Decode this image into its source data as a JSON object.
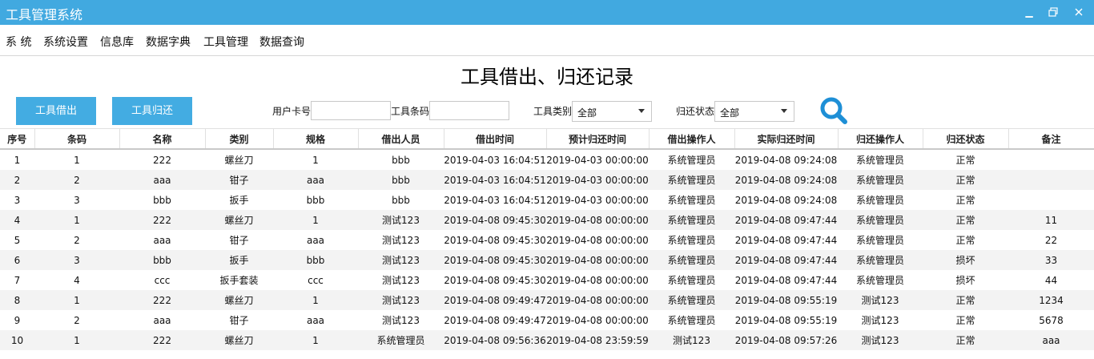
{
  "window": {
    "title": "工具管理系统"
  },
  "menu": [
    "系 统",
    "系统设置",
    "信息库",
    "数据字典",
    "工具管理",
    "数据查询"
  ],
  "page_title": "工具借出、归还记录",
  "buttons": {
    "borrow": "工具借出",
    "return": "工具归还"
  },
  "filters": {
    "card_label": "用户卡号",
    "card_value": "",
    "barcode_label": "工具条码",
    "barcode_value": "",
    "category_label": "工具类别",
    "category_value": "全部",
    "status_label": "归还状态",
    "status_value": "全部"
  },
  "table": {
    "headers": [
      "序号",
      "条码",
      "名称",
      "类别",
      "规格",
      "借出人员",
      "借出时间",
      "预计归还时间",
      "借出操作人",
      "实际归还时间",
      "归还操作人",
      "归还状态",
      "备注"
    ],
    "rows": [
      [
        "1",
        "1",
        "222",
        "螺丝刀",
        "1",
        "bbb",
        "2019-04-03 16:04:51",
        "2019-04-03 00:00:00",
        "系统管理员",
        "2019-04-08 09:24:08",
        "系统管理员",
        "正常",
        ""
      ],
      [
        "2",
        "2",
        "aaa",
        "钳子",
        "aaa",
        "bbb",
        "2019-04-03 16:04:51",
        "2019-04-03 00:00:00",
        "系统管理员",
        "2019-04-08 09:24:08",
        "系统管理员",
        "正常",
        ""
      ],
      [
        "3",
        "3",
        "bbb",
        "扳手",
        "bbb",
        "bbb",
        "2019-04-03 16:04:51",
        "2019-04-03 00:00:00",
        "系统管理员",
        "2019-04-08 09:24:08",
        "系统管理员",
        "正常",
        ""
      ],
      [
        "4",
        "1",
        "222",
        "螺丝刀",
        "1",
        "测试123",
        "2019-04-08 09:45:30",
        "2019-04-08 00:00:00",
        "系统管理员",
        "2019-04-08 09:47:44",
        "系统管理员",
        "正常",
        "11"
      ],
      [
        "5",
        "2",
        "aaa",
        "钳子",
        "aaa",
        "测试123",
        "2019-04-08 09:45:30",
        "2019-04-08 00:00:00",
        "系统管理员",
        "2019-04-08 09:47:44",
        "系统管理员",
        "正常",
        "22"
      ],
      [
        "6",
        "3",
        "bbb",
        "扳手",
        "bbb",
        "测试123",
        "2019-04-08 09:45:30",
        "2019-04-08 00:00:00",
        "系统管理员",
        "2019-04-08 09:47:44",
        "系统管理员",
        "损坏",
        "33"
      ],
      [
        "7",
        "4",
        "ccc",
        "扳手套装",
        "ccc",
        "测试123",
        "2019-04-08 09:45:30",
        "2019-04-08 00:00:00",
        "系统管理员",
        "2019-04-08 09:47:44",
        "系统管理员",
        "损坏",
        "44"
      ],
      [
        "8",
        "1",
        "222",
        "螺丝刀",
        "1",
        "测试123",
        "2019-04-08 09:49:47",
        "2019-04-08 00:00:00",
        "系统管理员",
        "2019-04-08 09:55:19",
        "测试123",
        "正常",
        "1234"
      ],
      [
        "9",
        "2",
        "aaa",
        "钳子",
        "aaa",
        "测试123",
        "2019-04-08 09:49:47",
        "2019-04-08 00:00:00",
        "系统管理员",
        "2019-04-08 09:55:19",
        "测试123",
        "正常",
        "5678"
      ],
      [
        "10",
        "1",
        "222",
        "螺丝刀",
        "1",
        "系统管理员",
        "2019-04-08 09:56:36",
        "2019-04-08 23:59:59",
        "测试123",
        "2019-04-08 09:57:26",
        "测试123",
        "正常",
        "aaa"
      ]
    ]
  },
  "colors": {
    "titlebar": "#41a9e0",
    "button": "#43ace2",
    "search_icon": "#1e8fd6",
    "row_alt": "#f3f3f3"
  },
  "icons": {
    "minimize": "minimize-icon",
    "restore": "restore-icon",
    "search": "search-icon"
  }
}
